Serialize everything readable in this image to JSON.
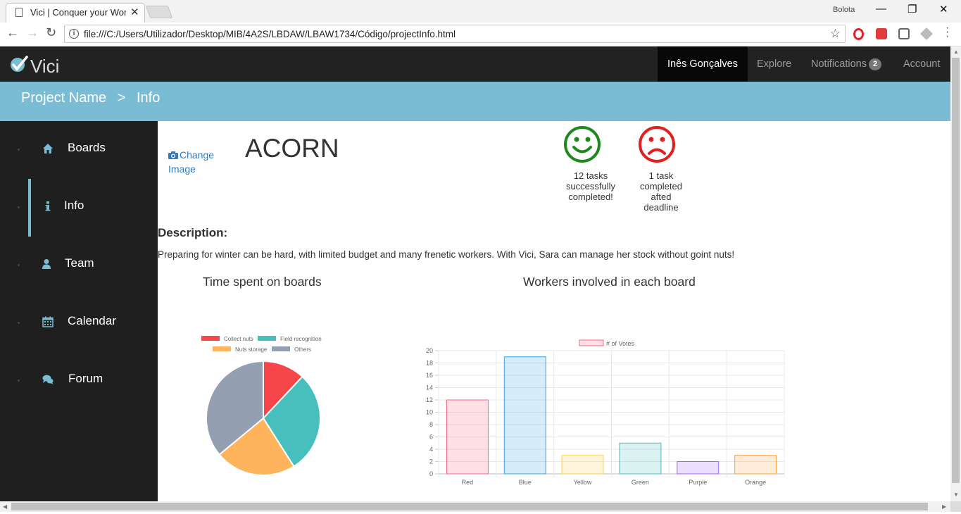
{
  "browser": {
    "tab_title": "Vici | Conquer your World",
    "url": "file:///C:/Users/Utilizador/Desktop/MIB/4A2S/LBDAW/LBAW1734/Código/projectInfo.html",
    "profile_name": "Bolota"
  },
  "nav": {
    "brand": "Vici",
    "user": "Inês Gonçalves",
    "explore": "Explore",
    "notifications": "Notifications",
    "notifications_count": "2",
    "account": "Account"
  },
  "breadcrumb": {
    "project": "Project Name",
    "separator": ">",
    "current": "Info"
  },
  "sidebar": {
    "items": [
      {
        "label": "Boards",
        "icon": "home-icon"
      },
      {
        "label": "Info",
        "icon": "info-icon"
      },
      {
        "label": "Team",
        "icon": "user-icon"
      },
      {
        "label": "Calendar",
        "icon": "calendar-icon"
      },
      {
        "label": "Forum",
        "icon": "comments-icon"
      }
    ],
    "active": "Info"
  },
  "project": {
    "change_image": "Change Image",
    "name": "ACORN",
    "stat_good": "12 tasks successfully completed!",
    "stat_bad": "1 task completed afted deadline",
    "description_heading": "Description:",
    "description": "Preparing for winter can be hard, with limited budget and many frenetic workers. With Vici, Sara can manage her stock without goint nuts!"
  },
  "colors": {
    "navbar": "#222222",
    "accent": "#7bbcd5",
    "happy": "#1e8a1e",
    "sad": "#e02020"
  },
  "chart_data": [
    {
      "type": "pie",
      "title": "Time spent on boards",
      "categories": [
        "Collect nuts",
        "Field recognition",
        "Nuts storage",
        "Others"
      ],
      "values": [
        12,
        29,
        23,
        36
      ],
      "colors": [
        "#f7464a",
        "#46bfbd",
        "#fdb45c",
        "#949fb1"
      ],
      "legend": "top"
    },
    {
      "type": "bar",
      "title": "Workers involved in each board",
      "categories": [
        "Red",
        "Blue",
        "Yellow",
        "Green",
        "Purple",
        "Orange"
      ],
      "series": [
        {
          "name": "# of Votes",
          "values": [
            12,
            19,
            3,
            5,
            2,
            3
          ]
        }
      ],
      "colors": [
        "#ff6384",
        "#36a2eb",
        "#ffce56",
        "#4bc0c0",
        "#9966ff",
        "#ff9f40"
      ],
      "ylim": [
        0,
        20
      ],
      "yticks": [
        0,
        2,
        4,
        6,
        8,
        10,
        12,
        14,
        16,
        18,
        20
      ],
      "grid": true,
      "legend": "top"
    }
  ]
}
